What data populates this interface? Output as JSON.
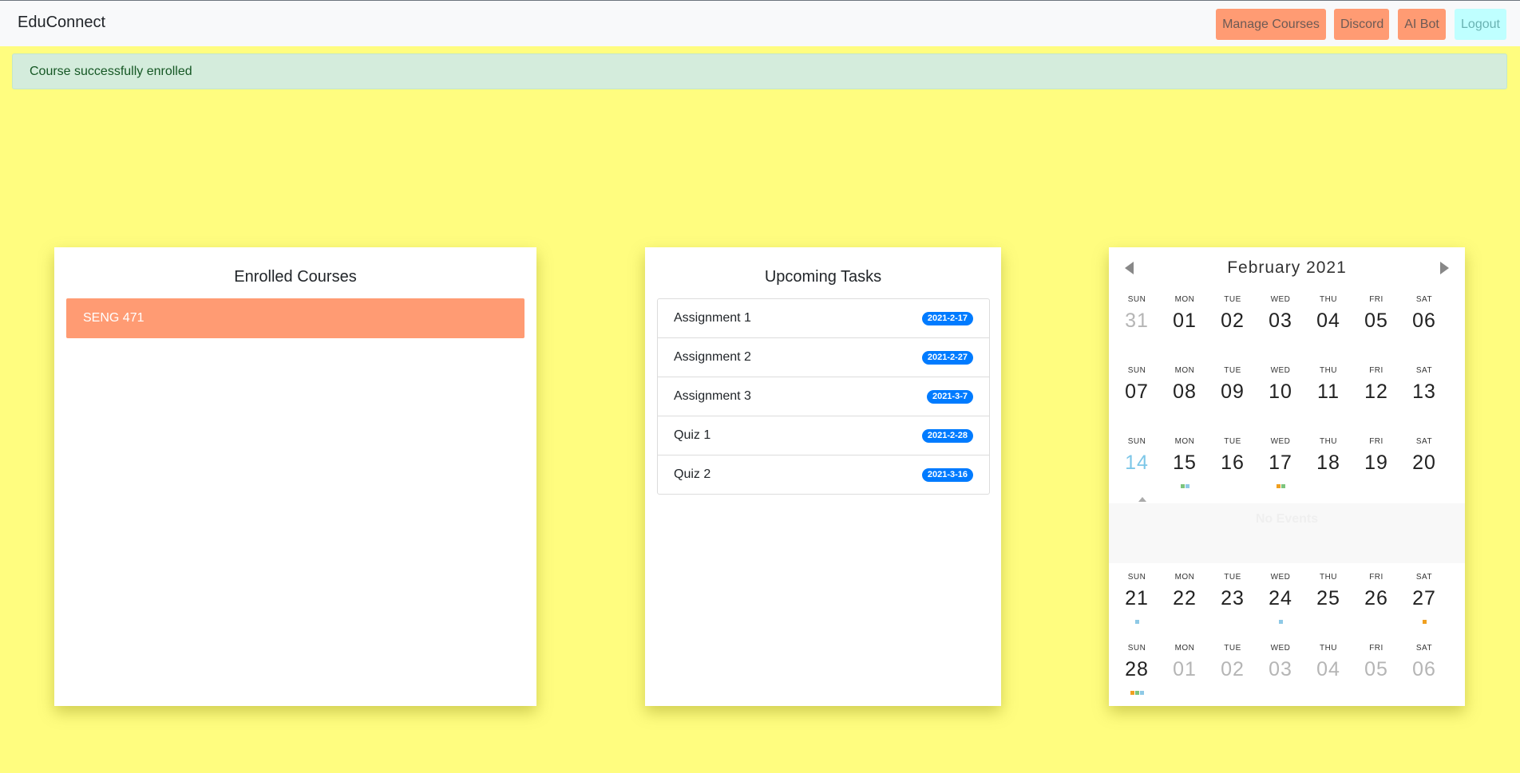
{
  "app": {
    "brand": "EduConnect"
  },
  "nav": {
    "manage_courses": "Manage Courses",
    "discord": "Discord",
    "ai_bot": "AI Bot",
    "logout": "Logout"
  },
  "alert": {
    "message": "Course successfully enrolled"
  },
  "enrolled": {
    "title": "Enrolled Courses",
    "courses": [
      "SENG 471"
    ]
  },
  "tasks": {
    "title": "Upcoming Tasks",
    "items": [
      {
        "name": "Assignment 1",
        "due": "2021-2-17"
      },
      {
        "name": "Assignment 2",
        "due": "2021-2-27"
      },
      {
        "name": "Assignment 3",
        "due": "2021-3-7"
      },
      {
        "name": "Quiz 1",
        "due": "2021-2-28"
      },
      {
        "name": "Quiz 2",
        "due": "2021-3-16"
      }
    ]
  },
  "calendar": {
    "month_label": "February 2021",
    "dow": [
      "SUN",
      "MON",
      "TUE",
      "WED",
      "THU",
      "FRI",
      "SAT"
    ],
    "no_events": "No Events",
    "colors": {
      "green": "#7dc47d",
      "blue": "#8ec9e6",
      "orange": "#f0a020"
    },
    "weeks": [
      [
        {
          "n": "31",
          "muted": true
        },
        {
          "n": "01"
        },
        {
          "n": "02"
        },
        {
          "n": "03"
        },
        {
          "n": "04"
        },
        {
          "n": "05"
        },
        {
          "n": "06"
        }
      ],
      [
        {
          "n": "07"
        },
        {
          "n": "08"
        },
        {
          "n": "09"
        },
        {
          "n": "10"
        },
        {
          "n": "11"
        },
        {
          "n": "12"
        },
        {
          "n": "13"
        }
      ],
      [
        {
          "n": "14",
          "today": true
        },
        {
          "n": "15",
          "dots": [
            "green",
            "blue"
          ]
        },
        {
          "n": "16"
        },
        {
          "n": "17",
          "dots": [
            "orange",
            "green"
          ]
        },
        {
          "n": "18"
        },
        {
          "n": "19"
        },
        {
          "n": "20"
        }
      ],
      [
        {
          "n": "21",
          "dots": [
            "blue"
          ]
        },
        {
          "n": "22"
        },
        {
          "n": "23"
        },
        {
          "n": "24",
          "dots": [
            "blue"
          ]
        },
        {
          "n": "25"
        },
        {
          "n": "26"
        },
        {
          "n": "27",
          "dots": [
            "orange"
          ]
        }
      ],
      [
        {
          "n": "28",
          "dots": [
            "orange",
            "green",
            "blue"
          ]
        },
        {
          "n": "01",
          "muted": true
        },
        {
          "n": "02",
          "muted": true
        },
        {
          "n": "03",
          "muted": true
        },
        {
          "n": "04",
          "muted": true
        },
        {
          "n": "05",
          "muted": true
        },
        {
          "n": "06",
          "muted": true
        }
      ]
    ]
  }
}
